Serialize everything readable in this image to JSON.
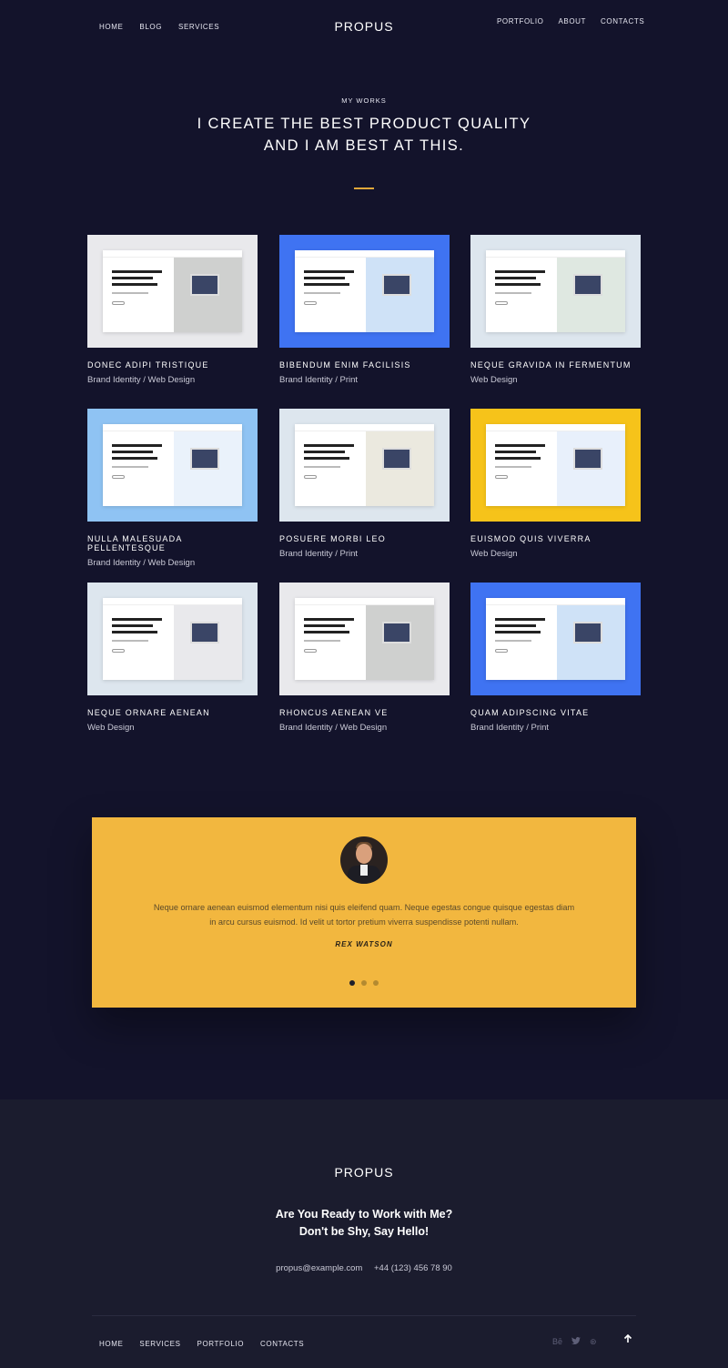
{
  "header": {
    "nav_left": [
      "HOME",
      "BLOG",
      "SERVICES"
    ],
    "logo": "PROPUS",
    "nav_right": [
      "PORTFOLIO",
      "ABOUT",
      "CONTACTS"
    ]
  },
  "intro": {
    "eyebrow": "MY WORKS",
    "headline_line1": "I CREATE THE BEST PRODUCT QUALITY",
    "headline_line2": "AND I AM BEST AT THIS."
  },
  "works": [
    {
      "title": "DONEC ADIPI TRISTIQUE",
      "category": "Brand Identity / Web Design",
      "bg": "#e9e9ec",
      "accent": "#cfd0cf"
    },
    {
      "title": "BIBENDUM ENIM FACILISIS",
      "category": "Brand Identity / Print",
      "bg": "#3f73f2",
      "accent": "#cfe2f7"
    },
    {
      "title": "NEQUE GRAVIDA IN FERMENTUM",
      "category": "Web Design",
      "bg": "#dde6ee",
      "accent": "#dfe8e1"
    },
    {
      "title": "NULLA MALESUADA PELLENTESQUE",
      "category": "Brand Identity / Web Design",
      "bg": "#8fc3f3",
      "accent": "#eaf2fb"
    },
    {
      "title": "POSUERE MORBI LEO",
      "category": "Brand Identity / Print",
      "bg": "#dde6ee",
      "accent": "#ebe9df"
    },
    {
      "title": "EUISMOD QUIS VIVERRA",
      "category": "Web Design",
      "bg": "#f6c31a",
      "accent": "#e8f0fb"
    },
    {
      "title": "NEQUE ORNARE AENEAN",
      "category": "Web Design",
      "bg": "#dde6ee",
      "accent": "#e9e9ec"
    },
    {
      "title": "RHONCUS AENEAN VE",
      "category": "Brand Identity / Web Design",
      "bg": "#e9e9ec",
      "accent": "#cfd0cf"
    },
    {
      "title": "QUAM ADIPSCING VITAE",
      "category": "Brand Identity / Print",
      "bg": "#3f73f2",
      "accent": "#cfe2f7"
    }
  ],
  "testimonial": {
    "quote": "Neque ornare aenean euismod elementum nisi quis eleifend quam. Neque egestas congue quisque egestas diam in arcu cursus euismod. Id velit ut tortor pretium viverra suspendisse potenti nullam.",
    "author": "REX WATSON",
    "active_dot": 1,
    "dot_count": 3
  },
  "footer": {
    "logo": "PROPUS",
    "cta_line1": "Are You Ready to Work with Me?",
    "cta_line2": "Don't be Shy, Say Hello!",
    "email": "propus@example.com",
    "phone": "+44 (123) 456 78 90",
    "nav": [
      "HOME",
      "SERVICES",
      "PORTFOLIO",
      "CONTACTS"
    ],
    "socials": [
      "behance-icon",
      "twitter-icon",
      "dribbble-icon"
    ],
    "social_glyphs": [
      "Bē",
      "🐦",
      "⊛"
    ]
  }
}
